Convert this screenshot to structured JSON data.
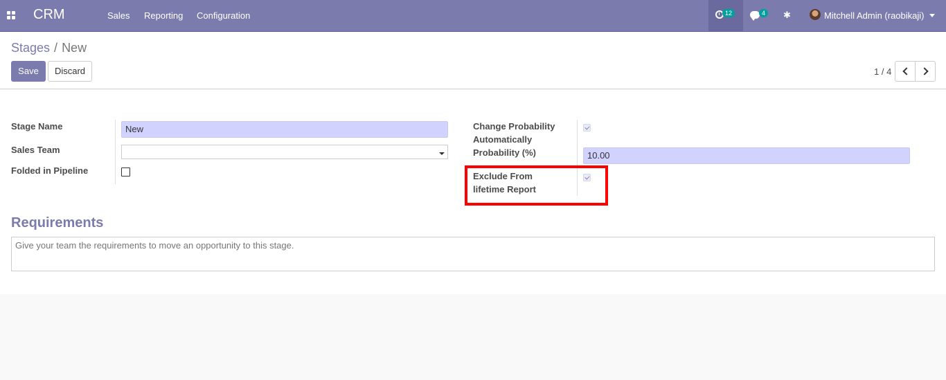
{
  "navbar": {
    "brand": "CRM",
    "menu": [
      "Sales",
      "Reporting",
      "Configuration"
    ],
    "activity_count": "12",
    "message_count": "4",
    "user_name": "Mitchell Admin (raobikaji)"
  },
  "control_panel": {
    "breadcrumb_parent": "Stages",
    "breadcrumb_separator": "/",
    "breadcrumb_current": "New",
    "save_label": "Save",
    "discard_label": "Discard",
    "pager": "1 / 4"
  },
  "form": {
    "stage_name_label": "Stage Name",
    "stage_name_value": "New",
    "sales_team_label": "Sales Team",
    "sales_team_value": "",
    "folded_label": "Folded in Pipeline",
    "folded_checked": false,
    "change_prob_label_1": "Change Probability",
    "change_prob_label_2": "Automatically",
    "change_prob_checked": true,
    "probability_label": "Probability (%)",
    "probability_value": "10.00",
    "exclude_label_1": "Exclude From",
    "exclude_label_2": "lifetime Report",
    "exclude_checked": true,
    "requirements_title": "Requirements",
    "requirements_placeholder": "Give your team the requirements to move an opportunity to this stage."
  },
  "colors": {
    "brand": "#7c7bad",
    "highlight": "#ff0000",
    "required_field": "#d2d2ff"
  }
}
